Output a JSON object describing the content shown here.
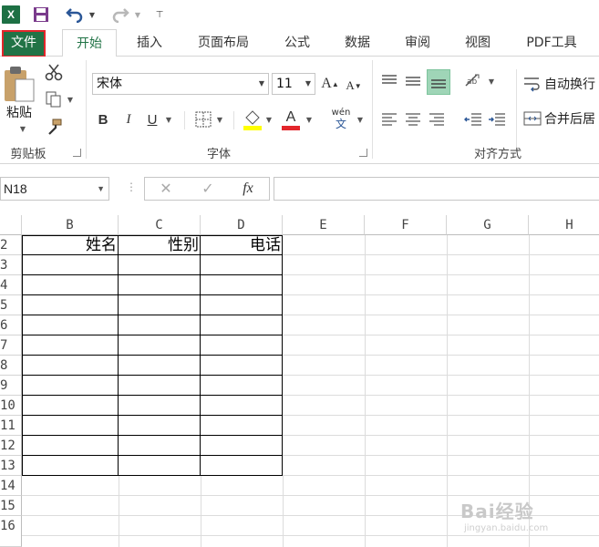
{
  "qat": {
    "logo_text": "X"
  },
  "tabs": [
    {
      "label": "文件"
    },
    {
      "label": "开始"
    },
    {
      "label": "插入"
    },
    {
      "label": "页面布局"
    },
    {
      "label": "公式"
    },
    {
      "label": "数据"
    },
    {
      "label": "审阅"
    },
    {
      "label": "视图"
    },
    {
      "label": "PDF工具"
    }
  ],
  "ribbon": {
    "clipboard": {
      "paste_label": "粘贴",
      "group_label": "剪贴板"
    },
    "font": {
      "font_name": "宋体",
      "font_size": "11",
      "grow_label": "A",
      "shrink_label": "A",
      "bold": "B",
      "italic": "I",
      "underline": "U",
      "font_color_label": "A",
      "phonetic_label": "wén",
      "group_label": "字体"
    },
    "alignment": {
      "wrap_text": "自动换行",
      "merge_center": "合并后居",
      "group_label": "对齐方式"
    }
  },
  "formula_bar": {
    "name_box": "N18",
    "fx_label": "fx"
  },
  "grid": {
    "columns": [
      "B",
      "C",
      "D",
      "E",
      "F",
      "G",
      "H"
    ],
    "rows": [
      "2",
      "3",
      "4",
      "5",
      "6",
      "7",
      "8",
      "9",
      "10",
      "11",
      "12",
      "13",
      "14",
      "15",
      "16"
    ],
    "headers": {
      "B2": "姓名",
      "C2": "性别",
      "D2": "电话"
    }
  },
  "watermark": {
    "brand": "Bai经验",
    "url": "jingyan.baidu.com"
  }
}
